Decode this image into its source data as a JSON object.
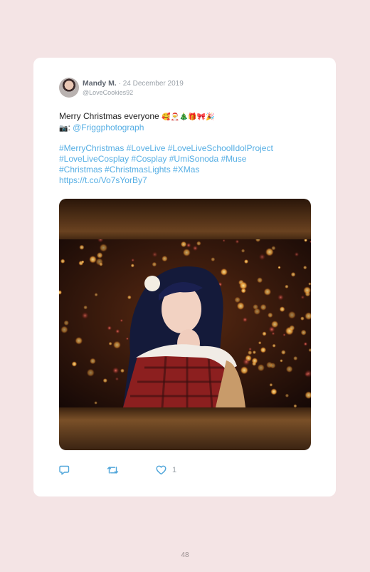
{
  "tweet": {
    "author_name": "Mandy M.",
    "date": " · 24 December 2019",
    "handle": "@LoveCookies92",
    "text_line1": "Merry Christmas everyone",
    "line1_emojis": "🥰🎅🎄🎁🎀🎉",
    "camera_emoji": "📷",
    "camera_sep": ": ",
    "mention": "@Friggphotograph",
    "hashtags_line1": "#MerryChristmas #LoveLive #LoveLiveSchoolIdolProject",
    "hashtags_line2": "#LoveLiveCosplay #Cosplay #UmiSonoda #Muse",
    "hashtags_line3": "#Christmas #ChristmasLights #XMas",
    "link": "https://t.co/Vo7sYorBy7",
    "like_count": "1"
  },
  "icons": [
    "avatar",
    "reply-icon",
    "retweet-icon",
    "like-icon"
  ],
  "colors": {
    "page_bg": "#f4e4e5",
    "card_bg": "#ffffff",
    "link": "#55aee4",
    "muted": "#9aa1a8"
  },
  "page_number": "48"
}
